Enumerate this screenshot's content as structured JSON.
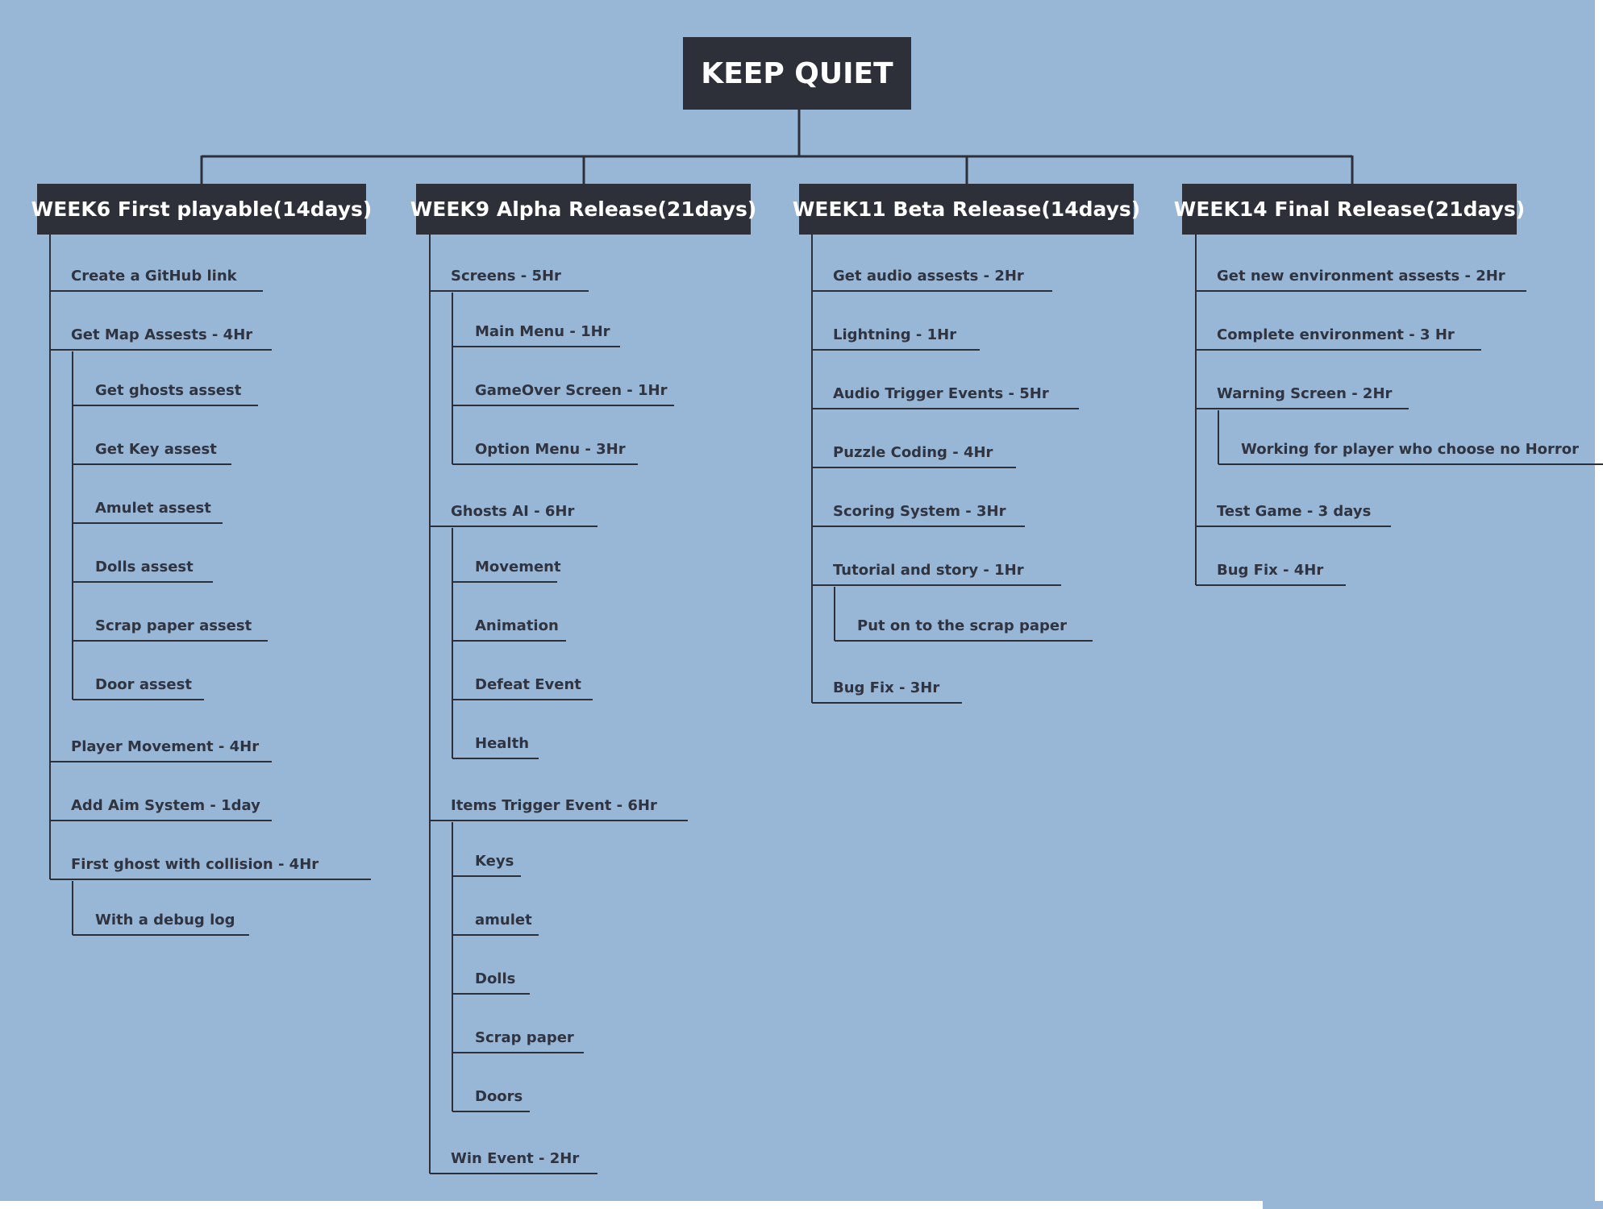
{
  "title": "KEEP QUIET",
  "weeks": [
    {
      "label": "WEEK6 First playable(14days)",
      "items": [
        {
          "label": "Create a GitHub link",
          "children": []
        },
        {
          "label": "Get Map Assests - 4Hr",
          "children": [
            "Get ghosts assest",
            "Get Key assest",
            "Amulet assest",
            "Dolls assest",
            "Scrap paper assest",
            "Door assest"
          ]
        },
        {
          "label": "Player Movement - 4Hr",
          "children": []
        },
        {
          "label": "Add Aim System - 1day",
          "children": []
        },
        {
          "label": "First ghost with collision - 4Hr",
          "children": [
            "With a debug log"
          ]
        }
      ]
    },
    {
      "label": "WEEK9 Alpha Release(21days)",
      "items": [
        {
          "label": "Screens  - 5Hr",
          "children": [
            "Main Menu - 1Hr",
            "GameOver Screen - 1Hr",
            "Option Menu - 3Hr"
          ]
        },
        {
          "label": "Ghosts AI - 6Hr",
          "children": [
            "Movement",
            "Animation",
            "Defeat Event",
            "Health"
          ]
        },
        {
          "label": "Items Trigger Event - 6Hr",
          "children": [
            "Keys",
            "amulet",
            "Dolls",
            "Scrap paper",
            "Doors"
          ]
        },
        {
          "label": "Win Event - 2Hr",
          "children": []
        }
      ]
    },
    {
      "label": "WEEK11 Beta Release(14days)",
      "items": [
        {
          "label": "Get audio assests - 2Hr",
          "children": []
        },
        {
          "label": "Lightning - 1Hr",
          "children": []
        },
        {
          "label": "Audio Trigger Events - 5Hr",
          "children": []
        },
        {
          "label": "Puzzle Coding - 4Hr",
          "children": []
        },
        {
          "label": "Scoring System - 3Hr",
          "children": []
        },
        {
          "label": "Tutorial and story - 1Hr",
          "children": [
            "Put on to the scrap paper"
          ]
        },
        {
          "label": "Bug Fix - 3Hr",
          "children": []
        }
      ]
    },
    {
      "label": "WEEK14 Final Release(21days)",
      "items": [
        {
          "label": "Get new environment assests - 2Hr",
          "children": []
        },
        {
          "label": "Complete environment  - 3 Hr",
          "children": []
        },
        {
          "label": "Warning Screen - 2Hr",
          "children": [
            "Working for player who choose no Horror"
          ]
        },
        {
          "label": "Test Game - 3 days",
          "children": []
        },
        {
          "label": "Bug Fix - 4Hr",
          "children": []
        }
      ]
    }
  ],
  "colors": {
    "background": "#98b6d6",
    "box": "#2e3039",
    "line": "#2e3039",
    "text": "#2f3440"
  }
}
